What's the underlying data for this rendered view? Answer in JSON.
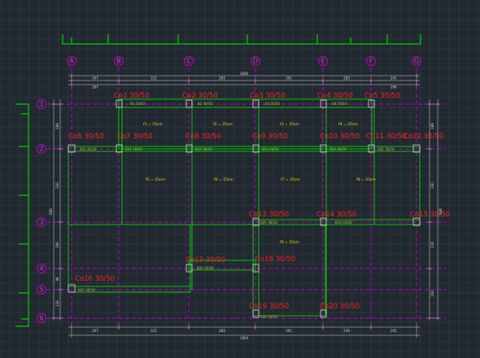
{
  "plan": {
    "axes_x": [
      "A",
      "B",
      "C",
      "D",
      "E",
      "F",
      "G"
    ],
    "axes_y": [
      "1",
      "2",
      "3",
      "4",
      "5",
      "6"
    ],
    "colors": {
      "background": "#212830",
      "axis": "#c000c0",
      "beam": "#00c800",
      "column_label": "#ff2020",
      "slab_label": "#f0e000",
      "beam_label": "#9acd32",
      "dimension": "#d8d8d8"
    },
    "dimensions": {
      "top_segments": [
        "267",
        "311",
        "283",
        "301",
        "283",
        "201"
      ],
      "top_total": "1646",
      "top_partial": "267",
      "top_partial_right": "266",
      "bottom_segments": [
        "267",
        "311",
        "283",
        "301",
        "239",
        "201"
      ],
      "bottom_total": "1604",
      "left_segments": [
        "189",
        "320",
        "190",
        "96",
        "124"
      ],
      "left_total": "689",
      "right_segments": [
        "189",
        "330",
        "116",
        "104"
      ],
      "right_total": "638"
    },
    "columns": [
      {
        "label": "Co1  30/50"
      },
      {
        "label": "Co2  30/50"
      },
      {
        "label": "Co3  30/50"
      },
      {
        "label": "Co4  30/50"
      },
      {
        "label": "Co5  30/50"
      },
      {
        "label": "Co6  30/50"
      },
      {
        "label": "Co7  30/50"
      },
      {
        "label": "Co8  30/50"
      },
      {
        "label": "Co9  30/50"
      },
      {
        "label": "Co10  30/50"
      },
      {
        "label": "Co11  30/50"
      },
      {
        "label": "Co12  30/50"
      },
      {
        "label": "Co13  30/50"
      },
      {
        "label": "Co14  30/50"
      },
      {
        "label": "Co15  30/50"
      },
      {
        "label": "Co16  30/50"
      },
      {
        "label": "Co17  30/50"
      },
      {
        "label": "Co18  30/50"
      },
      {
        "label": "Co19  30/50"
      },
      {
        "label": "Co20  30/50"
      }
    ],
    "slabs": [
      {
        "label": "f1 = 25cm"
      },
      {
        "label": "f2 = 25cm"
      },
      {
        "label": "f3 = 25cm"
      },
      {
        "label": "f4 = 25cm"
      },
      {
        "label": "f5 = 25cm"
      },
      {
        "label": "f6 = 25cm"
      },
      {
        "label": "f7 = 25cm"
      },
      {
        "label": "f8 = 25cm"
      },
      {
        "label": "f9 = 25cm"
      }
    ],
    "beams": [
      {
        "label": "B1  30/50"
      },
      {
        "label": "B2  30/50"
      },
      {
        "label": "B3  30/50"
      },
      {
        "label": "B4  30/50"
      },
      {
        "label": "B10  30/50"
      },
      {
        "label": "B11  30/50"
      },
      {
        "label": "B12  30/50"
      },
      {
        "label": "B13  30/50"
      },
      {
        "label": "B14  30/50"
      },
      {
        "label": "B15  30/50"
      },
      {
        "label": "B20  30/50"
      },
      {
        "label": "B25  30/50"
      },
      {
        "label": "B26  30/50"
      },
      {
        "label": "B27  30/50"
      },
      {
        "label": "B28  30/50"
      }
    ]
  }
}
